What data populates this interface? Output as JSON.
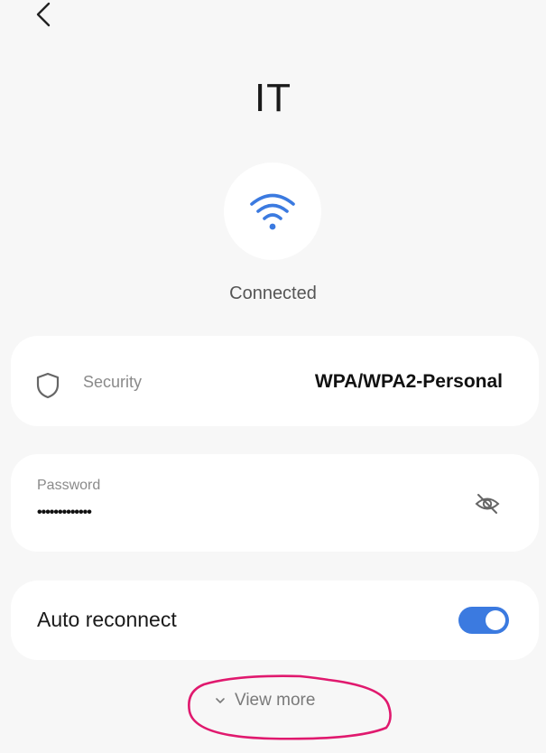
{
  "header": {
    "back_icon": "chevron-left-icon"
  },
  "network": {
    "name": "IT",
    "icon": "wifi-icon",
    "status": "Connected"
  },
  "security": {
    "icon": "shield-icon",
    "label": "Security",
    "value": "WPA/WPA2-Personal"
  },
  "password": {
    "label": "Password",
    "value": "•••••••••••••",
    "toggle_icon": "eye-off-icon"
  },
  "auto_reconnect": {
    "label": "Auto reconnect",
    "enabled": true
  },
  "view_more": {
    "icon": "chevron-down-icon",
    "label": "View more"
  },
  "colors": {
    "accent": "#3b7ae0",
    "annotation": "#e0196e",
    "background": "#f7f7f7",
    "card": "#ffffff"
  }
}
